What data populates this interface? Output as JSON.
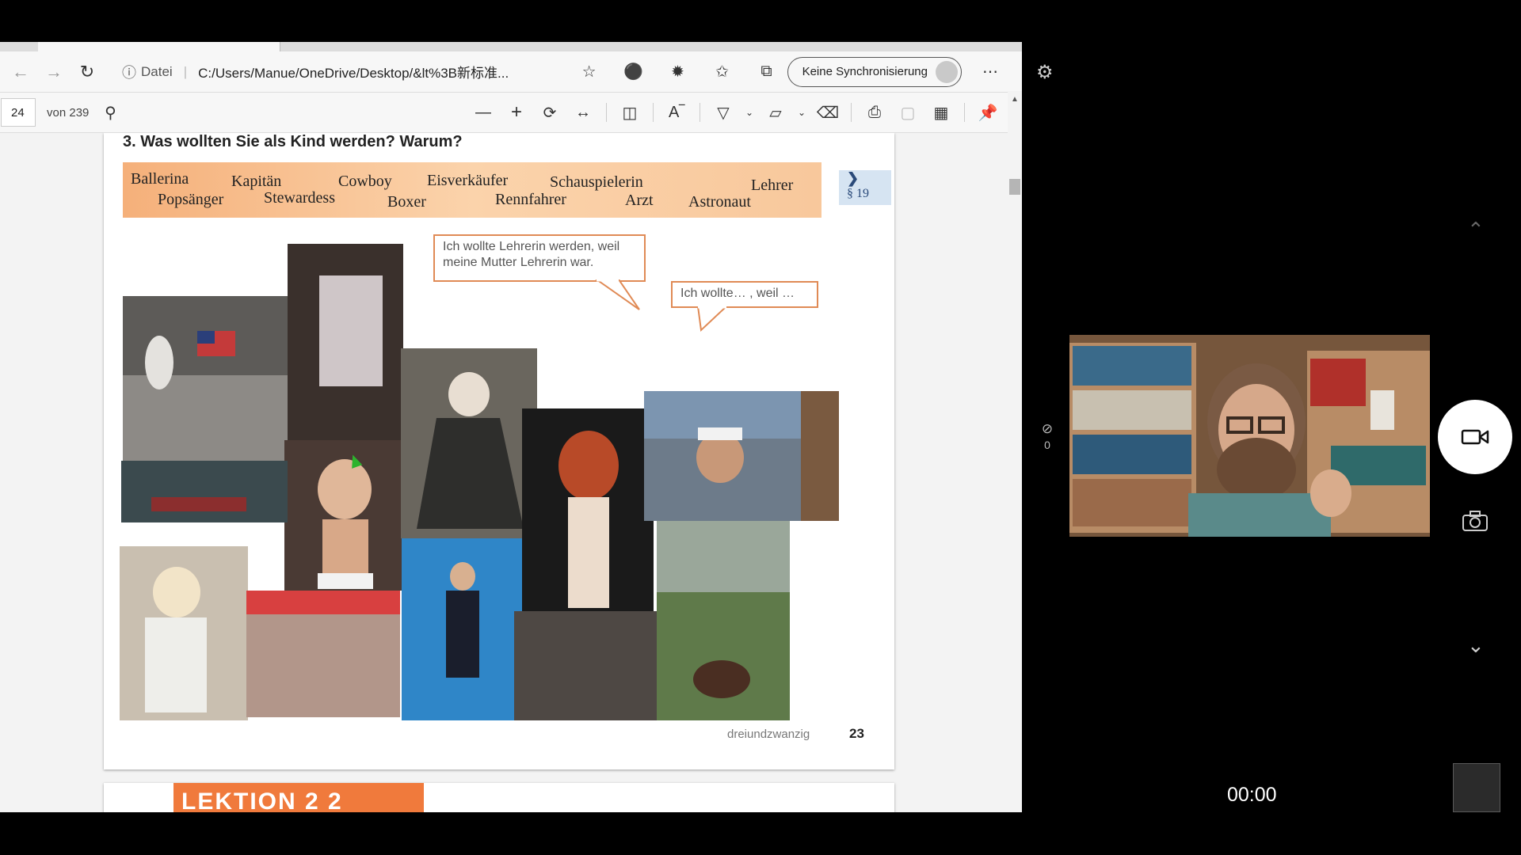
{
  "browser": {
    "address_prefix": "Datei",
    "address_url": "C:/Users/Manue/OneDrive/Desktop/&lt%3B新标准...",
    "sync_label": "Keine Synchronisierung"
  },
  "pdf_toolbar": {
    "page_number": "24",
    "page_total": "von 239"
  },
  "pdf_page": {
    "question": "3.  Was wollten Sie als Kind werden? Warum?",
    "words_row1": [
      "Ballerina",
      "Kapitän",
      "Cowboy",
      "Eisverkäufer",
      "Schauspielerin",
      "Lehrer"
    ],
    "words_row2": [
      "Popsänger",
      "Stewardess",
      "Boxer",
      "Rennfahrer",
      "Arzt",
      "Astronaut"
    ],
    "ref_chevron": "❯",
    "ref_label": "§ 19",
    "bubble1_line1": "Ich wollte Lehrerin werden, weil",
    "bubble1_line2": "meine Mutter Lehrerin war.",
    "bubble2": "Ich wollte… , weil …",
    "footer_word": "dreiundzwanzig",
    "footer_number": "23",
    "next_page_heading": "LEKTION 2 2"
  },
  "call": {
    "mute_count": "0",
    "timer": "00:00"
  }
}
